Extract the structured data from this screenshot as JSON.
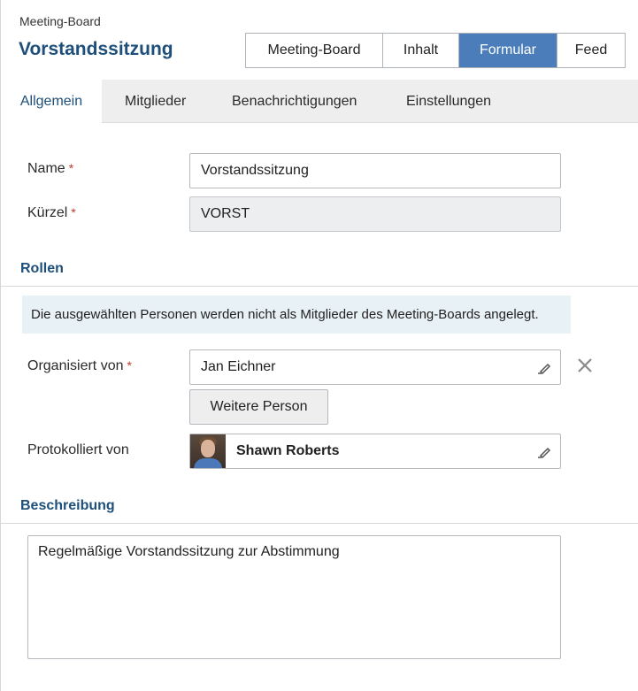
{
  "header": {
    "breadcrumb": "Meeting-Board",
    "title": "Vorstandssitzung"
  },
  "view_switch": {
    "items": [
      {
        "label": "Meeting-Board",
        "active": false
      },
      {
        "label": "Inhalt",
        "active": false
      },
      {
        "label": "Formular",
        "active": true
      },
      {
        "label": "Feed",
        "active": false
      }
    ]
  },
  "tabs": [
    {
      "label": "Allgemein",
      "active": true
    },
    {
      "label": "Mitglieder",
      "active": false
    },
    {
      "label": "Benachrichtigungen",
      "active": false
    },
    {
      "label": "Einstellungen",
      "active": false
    }
  ],
  "form": {
    "name": {
      "label": "Name",
      "required": "*",
      "value": "Vorstandssitzung"
    },
    "kuerzel": {
      "label": "Kürzel",
      "required": "*",
      "value": "VORST"
    }
  },
  "roles": {
    "title": "Rollen",
    "info": "Die ausgewählten Personen werden nicht als Mitglieder des Meeting-Boards angelegt.",
    "organized_by": {
      "label": "Organisiert von",
      "required": "*",
      "value": "Jan Eichner"
    },
    "add_person_label": "Weitere Person",
    "logged_by": {
      "label": "Protokolliert von",
      "value": "Shawn Roberts"
    }
  },
  "description": {
    "title": "Beschreibung",
    "value": "Regelmäßige Vorstandssitzung zur Abstimmung"
  },
  "colors": {
    "accent": "#4a7db9",
    "title": "#1d4f7a",
    "required": "#c0392b",
    "info_bg": "#e8f1f6"
  },
  "icons": {
    "edit": "pencil-icon",
    "clear": "close-icon"
  }
}
